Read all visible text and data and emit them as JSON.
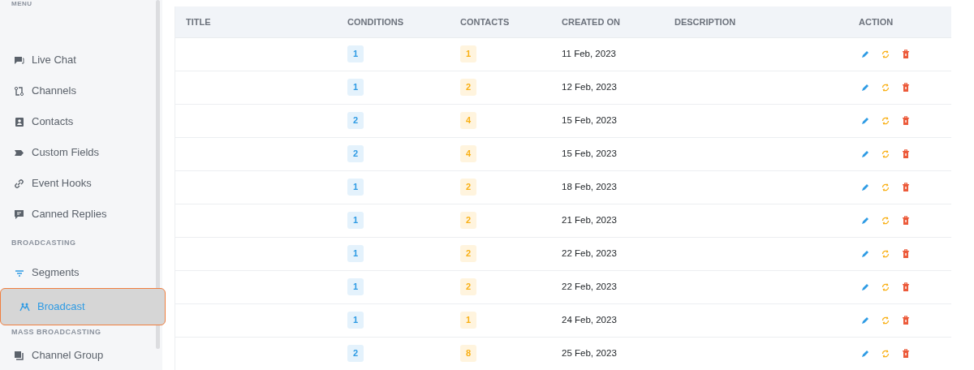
{
  "sidebar": {
    "heading": "MENU",
    "sections": [
      {
        "items": [
          {
            "label": "Live Chat",
            "selected": false
          },
          {
            "label": "Channels",
            "selected": false
          },
          {
            "label": "Contacts",
            "selected": false
          },
          {
            "label": "Custom Fields",
            "selected": false
          },
          {
            "label": "Event Hooks",
            "selected": false
          },
          {
            "label": "Canned Replies",
            "selected": false
          }
        ]
      },
      {
        "title": "BROADCASTING",
        "items": [
          {
            "label": "Segments",
            "selected": false,
            "highlighted": false
          },
          {
            "label": "Broadcast",
            "selected": true,
            "highlighted": true
          }
        ]
      },
      {
        "title": "MASS BROADCASTING",
        "items": [
          {
            "label": "Channel Group",
            "selected": false
          }
        ]
      }
    ]
  },
  "table": {
    "columns": [
      "TITLE",
      "CONDITIONS",
      "CONTACTS",
      "CREATED ON",
      "DESCRIPTION",
      "ACTION"
    ],
    "rows": [
      {
        "conditions": "1",
        "contacts": "1",
        "created_on": "11 Feb, 2023"
      },
      {
        "conditions": "1",
        "contacts": "2",
        "created_on": "12 Feb, 2023"
      },
      {
        "conditions": "2",
        "contacts": "4",
        "created_on": "15 Feb, 2023"
      },
      {
        "conditions": "2",
        "contacts": "4",
        "created_on": "15 Feb, 2023"
      },
      {
        "conditions": "1",
        "contacts": "2",
        "created_on": "18 Feb, 2023"
      },
      {
        "conditions": "1",
        "contacts": "2",
        "created_on": "21 Feb, 2023"
      },
      {
        "conditions": "1",
        "contacts": "2",
        "created_on": "22 Feb, 2023"
      },
      {
        "conditions": "1",
        "contacts": "2",
        "created_on": "22 Feb, 2023"
      },
      {
        "conditions": "1",
        "contacts": "1",
        "created_on": "24 Feb, 2023"
      },
      {
        "conditions": "2",
        "contacts": "8",
        "created_on": "25 Feb, 2023"
      }
    ]
  }
}
